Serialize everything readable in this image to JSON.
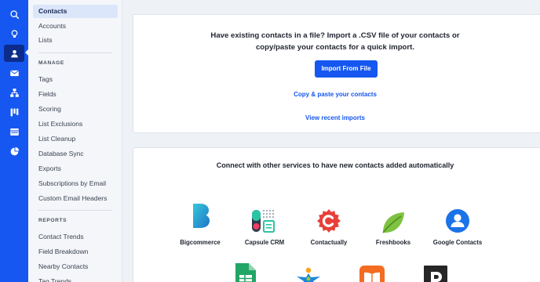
{
  "colors": {
    "brand_blue": "#1557f0",
    "rail_active": "#0c2c8c",
    "sidebar_bg": "#f4f6fa",
    "sidebar_active": "#dce6fb",
    "page_bg": "#eef1f6"
  },
  "rail": {
    "icons": [
      "search-icon",
      "lightbulb-icon",
      "contacts-icon",
      "mail-icon",
      "automation-icon",
      "deals-icon",
      "site-icon",
      "reports-icon"
    ],
    "active": "contacts-icon"
  },
  "sidebar": {
    "top_items": [
      {
        "label": "Contacts",
        "active": true
      },
      {
        "label": "Accounts"
      },
      {
        "label": "Lists"
      }
    ],
    "manage_heading": "MANAGE",
    "manage_items": [
      {
        "label": "Tags"
      },
      {
        "label": "Fields"
      },
      {
        "label": "Scoring"
      },
      {
        "label": "List Exclusions"
      },
      {
        "label": "List Cleanup"
      },
      {
        "label": "Database Sync"
      },
      {
        "label": "Exports"
      },
      {
        "label": "Subscriptions by Email"
      },
      {
        "label": "Custom Email Headers"
      }
    ],
    "reports_heading": "REPORTS",
    "reports_items": [
      {
        "label": "Contact Trends"
      },
      {
        "label": "Field Breakdown"
      },
      {
        "label": "Nearby Contacts"
      },
      {
        "label": "Tag Trends"
      }
    ]
  },
  "import_card": {
    "text_line1": "Have existing contacts in a file? Import a .CSV file of your contacts or",
    "text_line2": "copy/paste your contacts for a quick import.",
    "import_button": "Import From File",
    "paste_link": "Copy & paste your contacts",
    "recent_link": "View recent imports"
  },
  "connect_card": {
    "title": "Connect with other services to have new contacts added automatically",
    "services": [
      {
        "name": "Bigcommerce",
        "icon": "bigcommerce-logo"
      },
      {
        "name": "Capsule CRM",
        "icon": "capsule-crm-logo"
      },
      {
        "name": "Contactually",
        "icon": "contactually-logo"
      },
      {
        "name": "Freshbooks",
        "icon": "freshbooks-logo"
      },
      {
        "name": "Google Contacts",
        "icon": "google-contacts-logo"
      }
    ],
    "services_row2": [
      {
        "icon": "google-sheets-logo"
      },
      {
        "icon": "star-person-logo"
      },
      {
        "icon": "book-logo"
      },
      {
        "icon": "p-logo"
      }
    ]
  }
}
